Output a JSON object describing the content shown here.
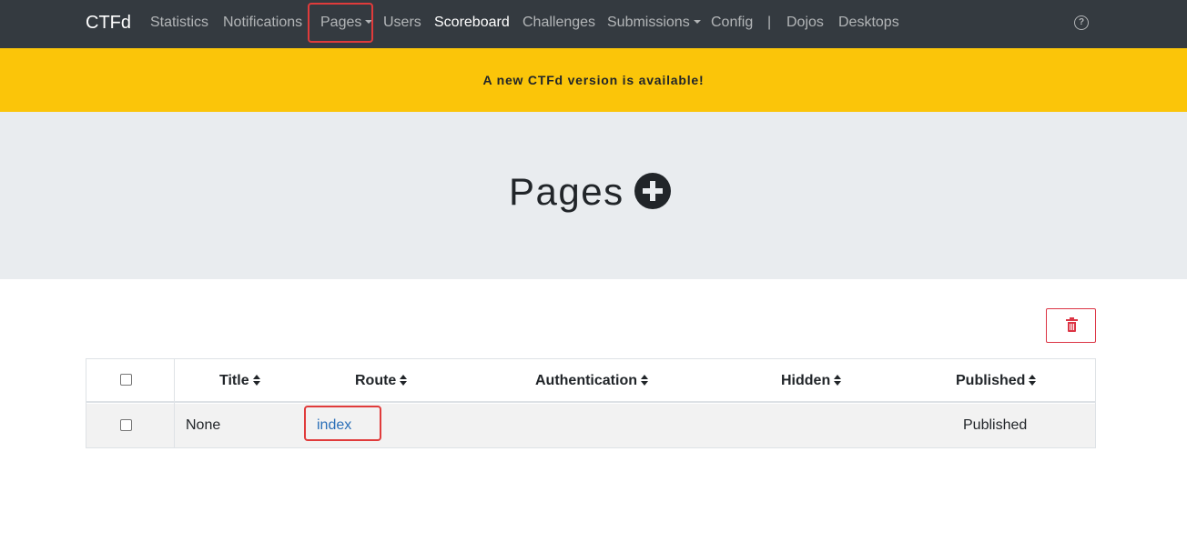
{
  "navbar": {
    "brand": "CTFd",
    "items": [
      {
        "label": "Statistics"
      },
      {
        "label": "Notifications"
      },
      {
        "label": "Pages"
      },
      {
        "label": "Users"
      },
      {
        "label": "Scoreboard"
      },
      {
        "label": "Challenges"
      },
      {
        "label": "Submissions"
      },
      {
        "label": "Config"
      },
      {
        "label": "Dojos"
      },
      {
        "label": "Desktops"
      }
    ],
    "separator": "|",
    "help_icon": "question-circle-icon",
    "active_item": "Scoreboard"
  },
  "alert": {
    "text": "A new CTFd version is available!",
    "color": "#fbc509"
  },
  "header": {
    "title": "Pages",
    "add_icon": "plus-circle-icon"
  },
  "toolbar": {
    "delete_icon": "trash-icon",
    "delete_color": "#dc3545"
  },
  "table": {
    "columns": [
      "Title",
      "Route",
      "Authentication",
      "Hidden",
      "Published"
    ],
    "rows": [
      {
        "title": "None",
        "route": "index",
        "authentication": "",
        "hidden": "",
        "published": "Published"
      }
    ]
  },
  "highlight_color": "#e03b3b",
  "link_color": "#2a6fb8"
}
